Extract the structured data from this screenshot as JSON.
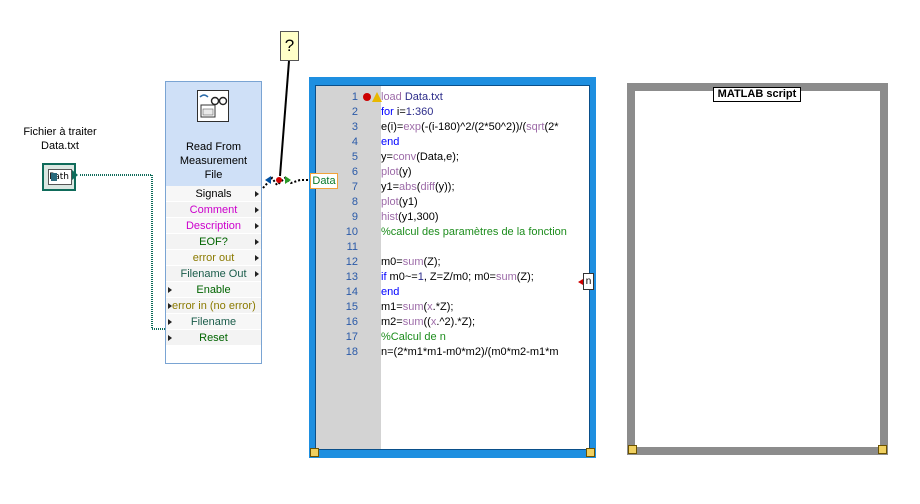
{
  "path_control": {
    "label_line1": "Fichier à traiter",
    "label_line2": "Data.txt",
    "terminal_text": "Path"
  },
  "probe": {
    "text": "?"
  },
  "express_vi": {
    "title_lines": [
      "Read From",
      "Measurement",
      "File"
    ],
    "rows": [
      {
        "label": "Signals",
        "color": "#000000",
        "dir": "out"
      },
      {
        "label": "Comment",
        "color": "#cc00cc",
        "dir": "out"
      },
      {
        "label": "Description",
        "color": "#cc00cc",
        "dir": "out"
      },
      {
        "label": "EOF?",
        "color": "#006400",
        "dir": "out"
      },
      {
        "label": "error out",
        "color": "#8b7a00",
        "dir": "out"
      },
      {
        "label": "Filename Out",
        "color": "#1a5c4a",
        "dir": "out"
      },
      {
        "label": "Enable",
        "color": "#006400",
        "dir": "in"
      },
      {
        "label": "error in (no error)",
        "color": "#8b7a00",
        "dir": "in"
      },
      {
        "label": "Filename",
        "color": "#1a5c4a",
        "dir": "in"
      },
      {
        "label": "Reset",
        "color": "#006400",
        "dir": "in"
      }
    ]
  },
  "mathscript": {
    "input_terminal": "Data",
    "output_terminal": "n",
    "lines": [
      {
        "n": "1",
        "html": "<span class='fn'>load</span> <span class='ds'>Data.txt</span>"
      },
      {
        "n": "2",
        "html": "<span class='kw'>for</span> i=<span class='ds'>1:360</span>"
      },
      {
        "n": "3",
        "html": " e(i)=<span class='fn'>exp</span>(-(i-180)^2/(2*50^2))/(<span class='fn'>sqrt</span>(2*"
      },
      {
        "n": "4",
        "html": "<span class='kw'>end</span>"
      },
      {
        "n": "5",
        "html": "y=<span class='fn'>conv</span>(Data,e);"
      },
      {
        "n": "6",
        "html": "<span class='fn'>plot</span>(y)"
      },
      {
        "n": "7",
        "html": "y1=<span class='fn'>abs</span>(<span class='fn'>diff</span>(y));"
      },
      {
        "n": "8",
        "html": "<span class='fn'>plot</span>(y1)"
      },
      {
        "n": "9",
        "html": "<span class='fn'>hist</span>(y1,300)"
      },
      {
        "n": "10",
        "html": "<span class='cm'>%calcul des paramètres de la fonction</span>"
      },
      {
        "n": "11",
        "html": ""
      },
      {
        "n": "12",
        "html": "m0=<span class='fn'>sum</span>(Z);"
      },
      {
        "n": "13",
        "html": "<span class='kw'>if</span> m0~=<span class='ds'>1</span>, Z=Z/m0; m0=<span class='fn'>sum</span>(Z);"
      },
      {
        "n": "14",
        "html": "<span class='kw'>end</span>"
      },
      {
        "n": "15",
        "html": "m1=<span class='fn'>sum</span>(<span class='fn'>x</span>.*Z);"
      },
      {
        "n": "16",
        "html": "m2=<span class='fn'>sum</span>((<span class='fn'>x</span>.^2).*Z);"
      },
      {
        "n": "17",
        "html": "<span class='cm'>%Calcul de n</span>"
      },
      {
        "n": "18",
        "html": "n=(2*m1*m1-m0*m2)/(m0*m2-m1*m"
      }
    ]
  },
  "matlab_node": {
    "label": "MATLAB script"
  },
  "colors": {
    "mathscript_frame": "#1e8fe0",
    "matlab_frame": "#8c8c8c",
    "path_wire": "#0f6b5a",
    "error_wire": "#d00000"
  }
}
